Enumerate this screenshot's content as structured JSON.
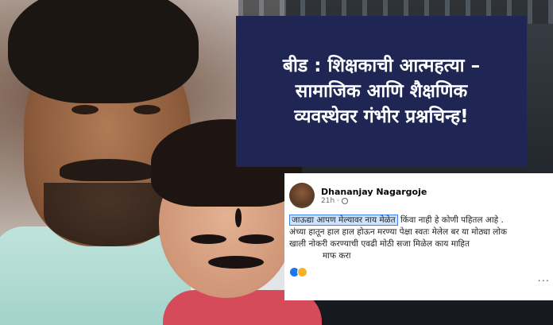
{
  "headline": {
    "lines": [
      "बीड :  शिक्षकाची आत्महत्या –",
      "सामाजिक आणि शैक्षणिक",
      "व्यवस्थेवर गंभीर प्रश्नचिन्ह!"
    ]
  },
  "post": {
    "author": "Dhananjay Nagargoje",
    "time": "21h",
    "separator": "·",
    "highlighted_text": "जाऊद्या आपण मेल्यावर नाय मेळेत",
    "line1_rest": " किंवा नाही हे कोणी पहितल आहे .",
    "line2": "अंच्या हातून हाल हाल होऊन मरण्या पेक्षा स्वतः मेलेल बर या मोठ्या लोक",
    "line3": "खाली नोकरी करण्याची एवढी मोठी सजा मिळेल काय माहित",
    "line4": "माफ करा",
    "reaction_icons": [
      "like-icon",
      "sad-icon"
    ],
    "more_icon": "..."
  },
  "colors": {
    "headline_bg": "#1f2653",
    "headline_text": "#ffffff",
    "highlight_bg": "#cfe3ff",
    "highlight_border": "#3b82f6"
  }
}
